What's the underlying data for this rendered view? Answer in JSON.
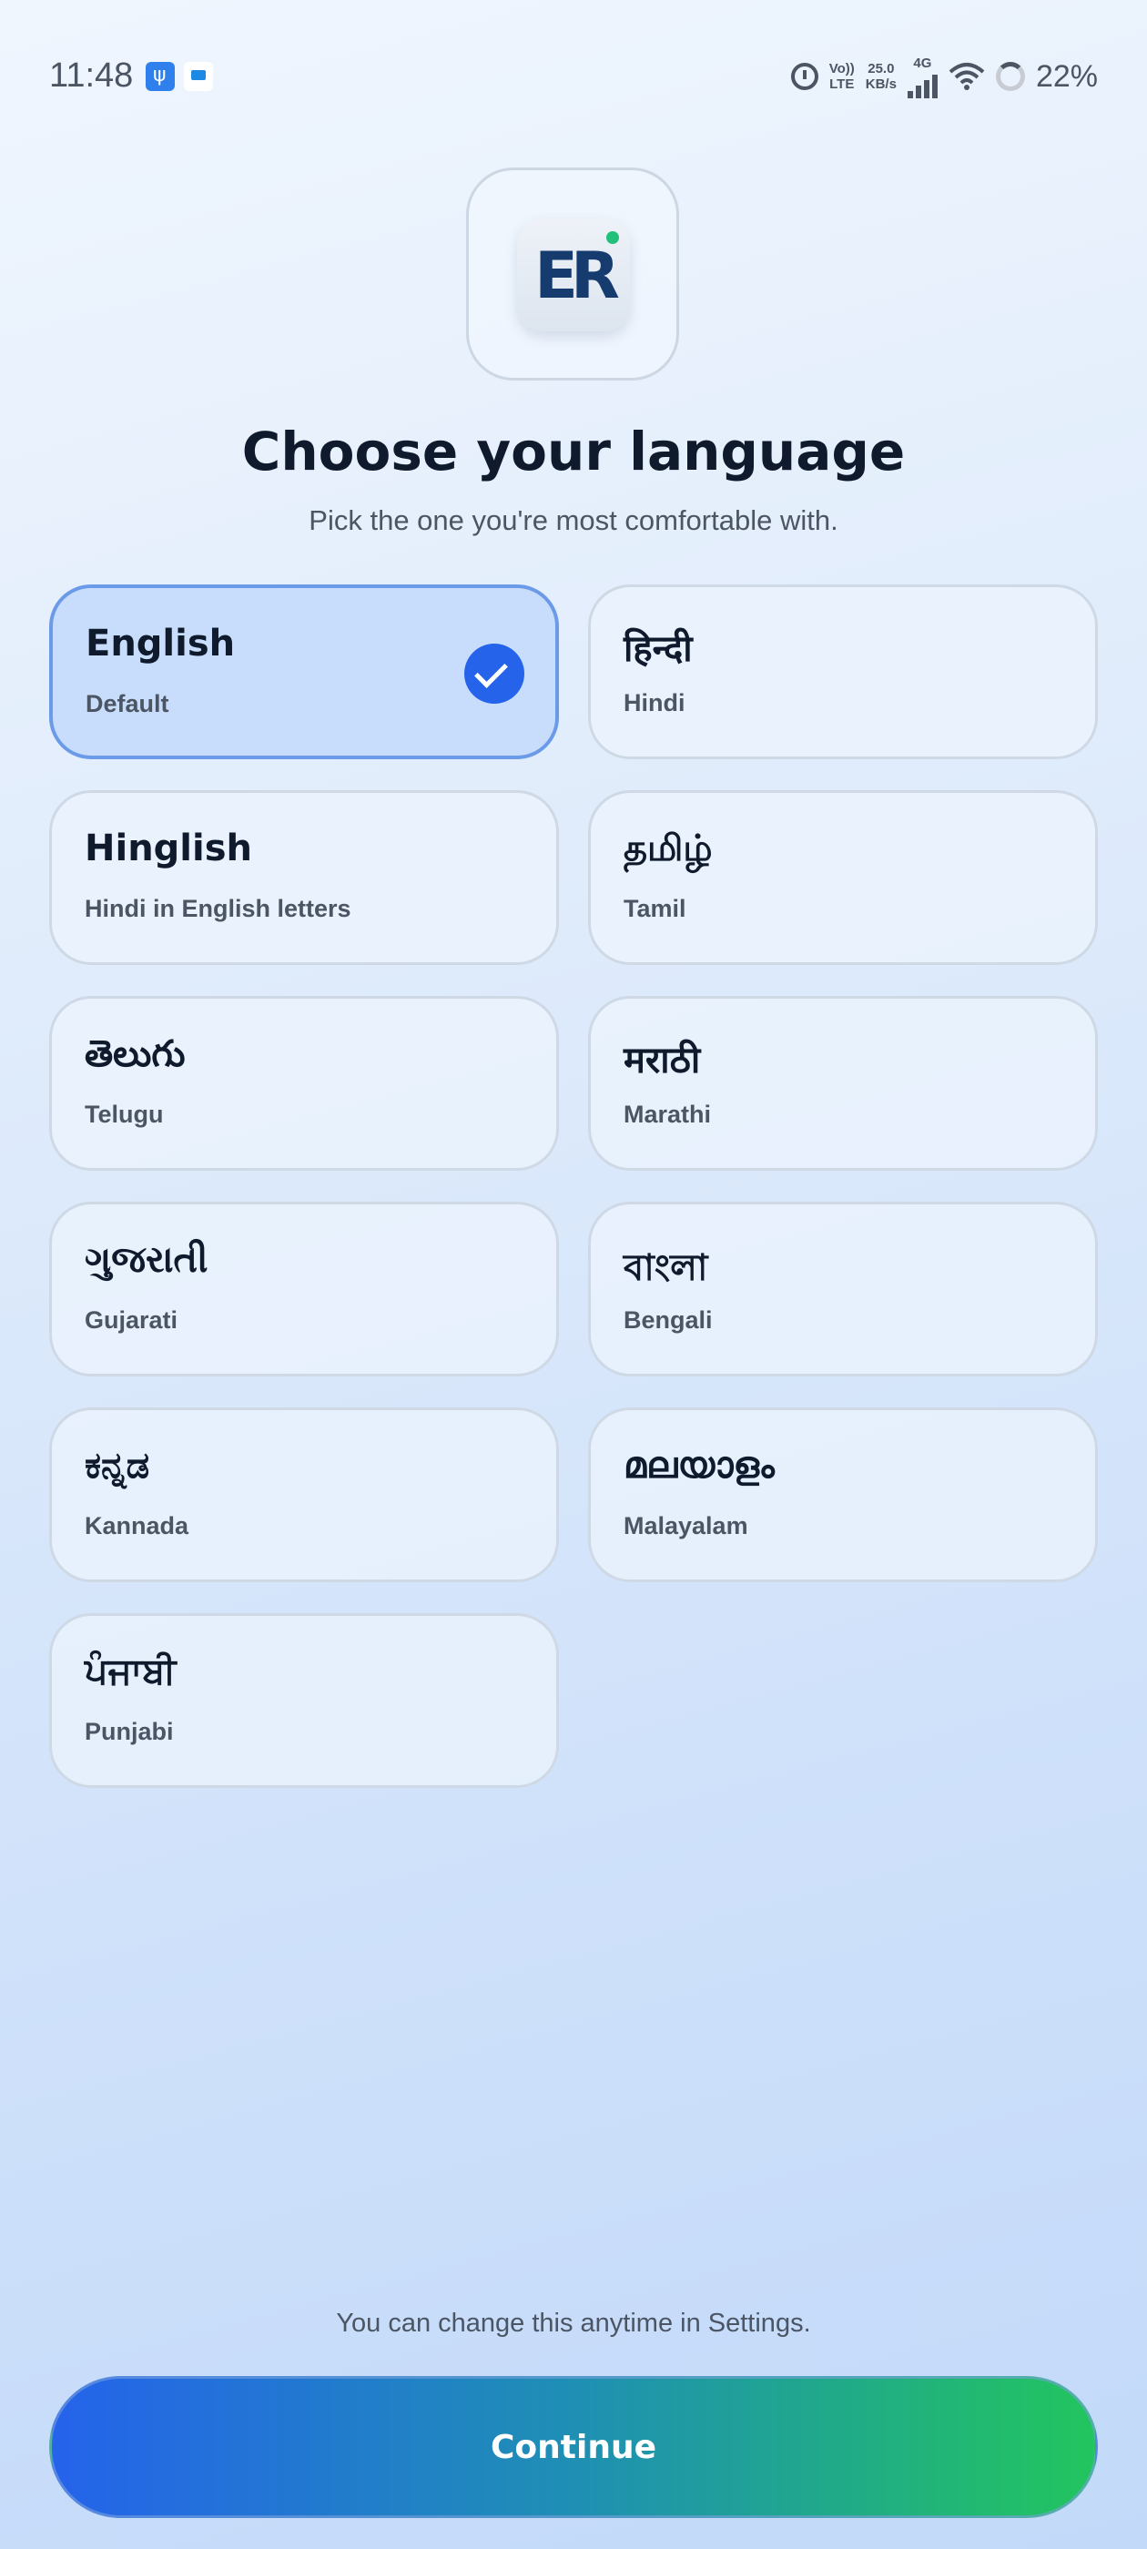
{
  "status_bar": {
    "time": "11:48",
    "volte_top": "Vo))",
    "volte_bottom": "LTE",
    "speed_value": "25.0",
    "speed_unit": "KB/s",
    "network": "4G",
    "battery": "22%"
  },
  "header": {
    "logo_text": "ER",
    "title": "Choose your language",
    "subtitle": "Pick the one you're most comfortable with."
  },
  "languages": [
    {
      "native": "English",
      "english": "Default",
      "selected": true
    },
    {
      "native": "हिन्दी",
      "english": "Hindi",
      "selected": false
    },
    {
      "native": "Hinglish",
      "english": "Hindi in English letters",
      "selected": false
    },
    {
      "native": "தமிழ்",
      "english": "Tamil",
      "selected": false
    },
    {
      "native": "తెలుగు",
      "english": "Telugu",
      "selected": false
    },
    {
      "native": "मराठी",
      "english": "Marathi",
      "selected": false
    },
    {
      "native": "ગુજરાતી",
      "english": "Gujarati",
      "selected": false
    },
    {
      "native": "বাংলা",
      "english": "Bengali",
      "selected": false
    },
    {
      "native": "ಕನ್ನಡ",
      "english": "Kannada",
      "selected": false
    },
    {
      "native": "മലയാളം",
      "english": "Malayalam",
      "selected": false
    },
    {
      "native": "ਪੰਜਾਬੀ",
      "english": "Punjabi",
      "selected": false
    }
  ],
  "footer": {
    "note": "You can change this anytime in Settings.",
    "continue_label": "Continue"
  },
  "colors": {
    "accent": "#2563eb",
    "accent_end": "#22c55e"
  }
}
